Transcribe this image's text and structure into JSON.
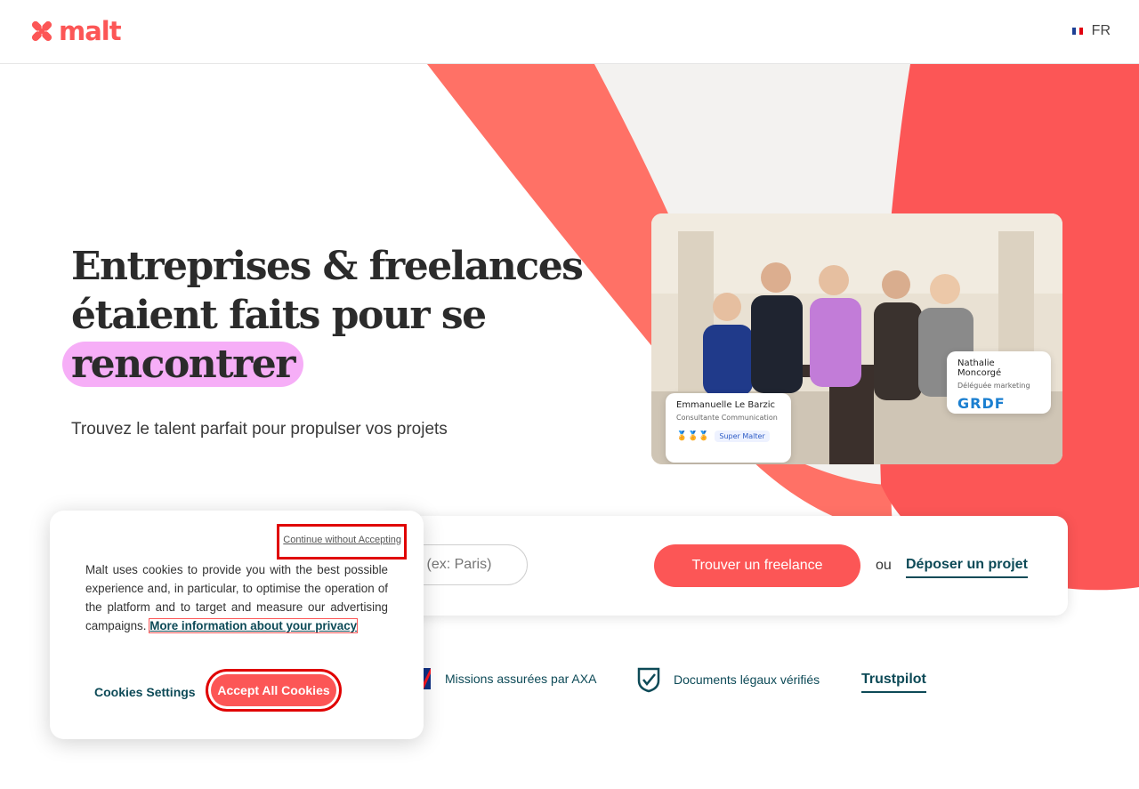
{
  "header": {
    "brand": "malt",
    "language": "FR"
  },
  "hero": {
    "title_line1": "Entreprises & freelances",
    "title_line2": "étaient faits pour se",
    "title_highlight": "rencontrer",
    "subtitle": "Trouvez le talent parfait pour propulser vos projets",
    "card1": {
      "name": "Emmanuelle Le Barzic",
      "role": "Consultante Communication",
      "badge": "Super Malter"
    },
    "card2": {
      "name": "Nathalie Moncorgé",
      "role": "Déléguée marketing",
      "logo": "GRDF"
    }
  },
  "search": {
    "placeholder": "Lieu de la mission (ex: Paris)",
    "find_label": "Trouver un freelance",
    "or_label": "ou",
    "post_label": "Déposer un projet"
  },
  "trust": {
    "axa": "Missions assurées par AXA",
    "docs": "Documents légaux vérifiés",
    "trustpilot": "Trustpilot"
  },
  "cookie": {
    "continue_label": "Continue without Accepting",
    "text": "Malt uses cookies to provide you with the best possible experience and, in particular, to optimise the operation of the platform and to target and measure our advertising campaigns.",
    "more_label": "More information about your privacy",
    "settings_label": "Cookies Settings",
    "accept_label": "Accept All Cookies"
  },
  "colors": {
    "brand": "#fc5656",
    "teal": "#0d4a57",
    "highlight": "#f6aef7"
  }
}
